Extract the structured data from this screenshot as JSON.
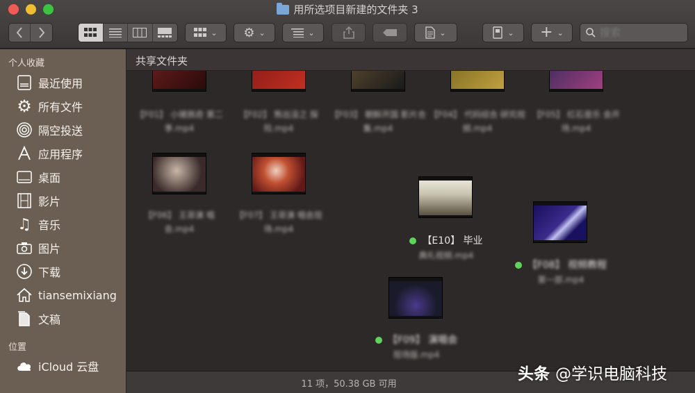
{
  "window": {
    "title": "用所选项目新建的文件夹 3"
  },
  "toolbar": {
    "back_icon": "chevron-left-icon",
    "forward_icon": "chevron-right-icon",
    "view_modes": [
      "icon-view",
      "list-view",
      "column-view",
      "gallery-view"
    ],
    "active_view": "icon-view",
    "group_icon": "grid-icon",
    "action_icon": "gear-icon",
    "arrange_icon": "arrange-icon",
    "share_icon": "share-icon",
    "tag_icon": "tag-icon",
    "doc_icon": "document-icon",
    "sync_icon": "sync-icon",
    "add_icon": "plus-icon",
    "search_placeholder": "搜索"
  },
  "sidebar": {
    "favorites_header": "个人收藏",
    "items": [
      {
        "label": "最近使用",
        "icon": "recents-icon"
      },
      {
        "label": "所有文件",
        "icon": "gear-icon"
      },
      {
        "label": "隔空投送",
        "icon": "airdrop-icon"
      },
      {
        "label": "应用程序",
        "icon": "applications-icon"
      },
      {
        "label": "桌面",
        "icon": "desktop-icon"
      },
      {
        "label": "影片",
        "icon": "film-icon"
      },
      {
        "label": "音乐",
        "icon": "music-icon"
      },
      {
        "label": "图片",
        "icon": "camera-icon"
      },
      {
        "label": "下载",
        "icon": "download-icon"
      },
      {
        "label": "tiansemixiang",
        "icon": "home-icon"
      },
      {
        "label": "文稿",
        "icon": "documents-icon"
      }
    ],
    "locations_header": "位置",
    "locations": [
      {
        "label": "iCloud 云盘",
        "icon": "cloud-icon"
      }
    ]
  },
  "pathbar": {
    "label": "共享文件夹"
  },
  "files": [
    {
      "name": "【F01】 小猪佩奇 第二季.mp4",
      "color": "#6a1e1e",
      "synced": false
    },
    {
      "name": "【F02】 熊出没之 探险.mp4",
      "color": "#8a1a1a",
      "synced": false
    },
    {
      "name": "【F03】 朝鲜开国 影片合集.mp4",
      "color": "#5a4a30",
      "synced": false
    },
    {
      "name": "【F04】 代码综合 研究视频.mp4",
      "color": "#7a6a20",
      "synced": false
    },
    {
      "name": "【F05】 红石音乐 会开场.mp4",
      "color": "#3a2a5a",
      "synced": false
    },
    {
      "name": "【F06】 王菲演 唱会.mp4",
      "color": "#8a7a70",
      "synced": false
    },
    {
      "name": "【F07】 王菲演 唱会现场.mp4",
      "color": "#c05030",
      "synced": false
    },
    {
      "name": "【E10】 毕业",
      "subname": "典礼视频.mp4",
      "color": "#c8c4b0",
      "synced": true
    },
    {
      "name": "【F08】 视频教程",
      "subname": "第一部.mp4",
      "color": "#3a2a8a",
      "synced": true
    },
    {
      "name": "【F09】 演唱会",
      "subname": "现场版.mp4",
      "color": "#1a1a2a",
      "synced": true
    }
  ],
  "status": {
    "text": "11 项，50.38 GB 可用"
  },
  "watermark": {
    "text1": "头条",
    "text2": "@学识电脑科技"
  }
}
